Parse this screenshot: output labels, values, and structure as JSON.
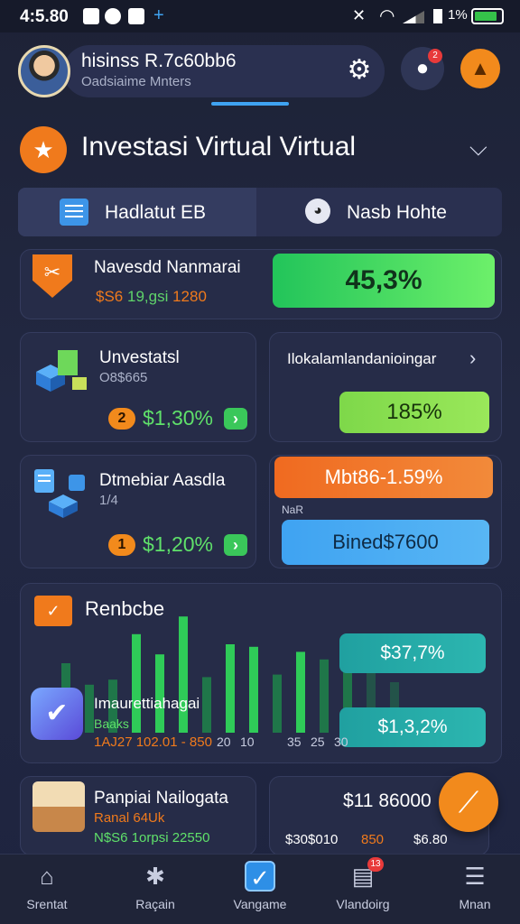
{
  "status": {
    "time": "4:5.80",
    "battery": "1%"
  },
  "header": {
    "user_name": "hisinss R.7c60bb6",
    "user_sub": "Oadsiaime Mnters",
    "notif_count": "2"
  },
  "section": {
    "title": "Investasi Virtual Virtual"
  },
  "tabs": [
    {
      "label": "Hadlatut EB"
    },
    {
      "label": "Nasb Hohte"
    }
  ],
  "row1": {
    "title": "Navesdd Nanmarai",
    "sub_a": "$S6",
    "sub_b": "19,gsi",
    "sub_c": "1280",
    "pill": "45,3%"
  },
  "row2": {
    "left": {
      "title": "Unvestatsl",
      "sub": "O8$665",
      "badge": "2",
      "value": "$1,30%",
      "go": "›"
    },
    "right": {
      "title": "Ilokalamlandanioingar",
      "chev": "›",
      "pill": "185%"
    }
  },
  "row3": {
    "left": {
      "title": "Dtmebiar Aasdla",
      "sub": "1/4",
      "badge": "1",
      "value": "$1,20%",
      "go": "›"
    },
    "right": {
      "orange_pill": "Mbt86-1.59%",
      "mini": "NaR",
      "blue_pill": "Bined$7600"
    }
  },
  "chart_card": {
    "title": "Renbcbe",
    "pill_top": "$37,7%",
    "pill_bottom": "$1,3,2%",
    "sub1": "Imaurettiahagai",
    "sub2": "Baaks",
    "sub3": "1AJ27 102.01 - 850",
    "ticks": [
      "20",
      "10",
      "35",
      "25",
      "30"
    ]
  },
  "chart_data": {
    "type": "bar",
    "title": "Renbcbe",
    "categories": [],
    "series": [
      {
        "values": [
          0.55,
          0.38,
          0.42,
          0.78,
          0.62,
          0.92,
          0.44,
          0.7,
          0.68,
          0.46,
          0.64,
          0.58,
          0.6,
          0.52,
          0.4
        ]
      }
    ]
  },
  "row5": {
    "left": {
      "title": "Panpiai Nailogata",
      "sub": "Ranal 64Uk",
      "sub2": "N$S6  1orpsi 22550"
    },
    "right": {
      "value": "$11 86000",
      "c1": "$30$010",
      "c2": "850",
      "c3": "$6.80"
    }
  },
  "nav": [
    {
      "label": "Srentat",
      "icon": "home-icon"
    },
    {
      "label": "Raçain",
      "icon": "compass-icon"
    },
    {
      "label": "Vangame",
      "icon": "check-icon"
    },
    {
      "label": "Vlandoirg",
      "icon": "document-icon",
      "badge": "13"
    },
    {
      "label": "Mnan",
      "icon": "menu-icon"
    }
  ],
  "colors": {
    "accent": "#f28a1c",
    "green": "#22c45a",
    "blue": "#3fa3f2",
    "bg": "#1d2236"
  }
}
